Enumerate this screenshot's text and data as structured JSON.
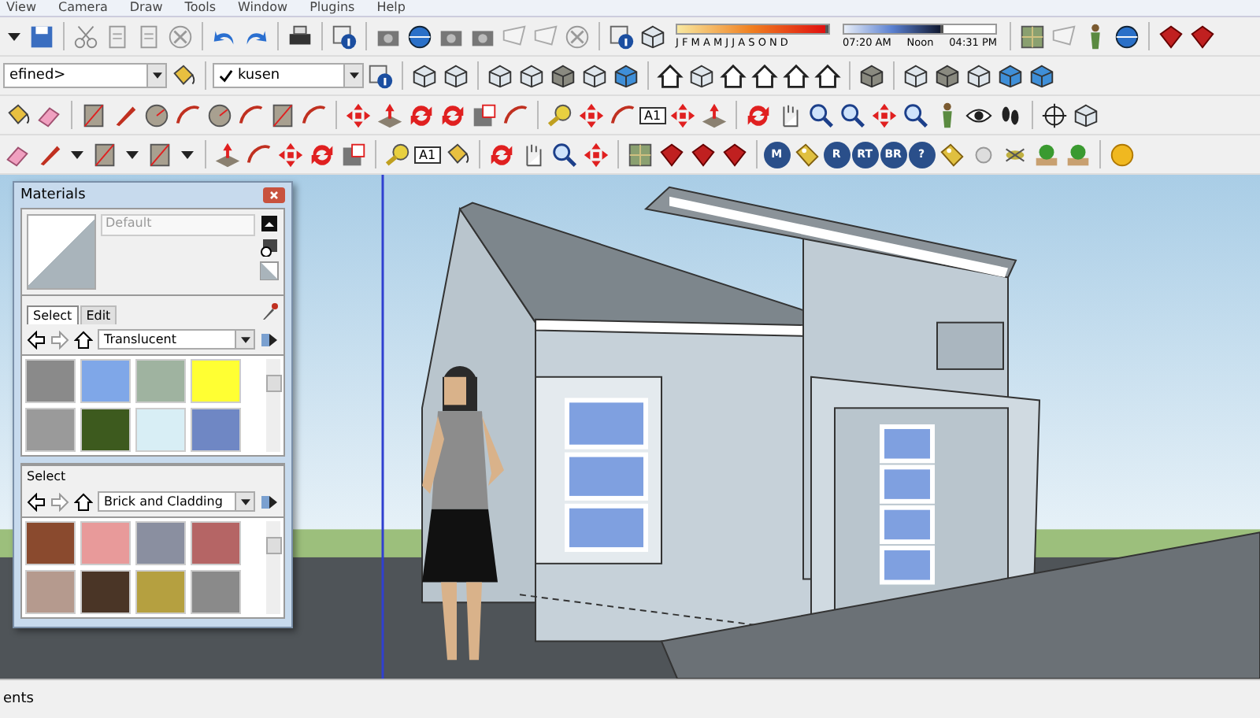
{
  "menu_bar": {
    "items": [
      "View",
      "Camera",
      "Draw",
      "Tools",
      "Window",
      "Plugins",
      "Help"
    ]
  },
  "layer_toolbar": {
    "layer": "efined>",
    "material": "kusen",
    "checked": true
  },
  "shadow_toolbar": {
    "month_slider": {
      "level": 1
    },
    "time_slider": {
      "level": 0.66
    },
    "months": "J F M A M J J A S O N D",
    "time_start": "07:20 AM",
    "time_middle": "Noon",
    "time_end": "04:31 PM"
  },
  "tool_labels": {
    "text_tool_row3": "A1",
    "text_tool_row4": "A1",
    "plugin_badges": [
      "M",
      "R",
      "RT",
      "BR",
      "?"
    ]
  },
  "materials": {
    "title": "Materials",
    "material_name": "Default",
    "tabs": [
      {
        "label": "Select",
        "selected": true
      },
      {
        "label": "Edit",
        "selected": false
      }
    ],
    "collection": "Translucent",
    "swatches": [
      {
        "color": "#8a8a8a"
      },
      {
        "color": "#7fa7e8"
      },
      {
        "color": "#9fb3a0"
      },
      {
        "color": "#ffff33"
      },
      {
        "color": "#9a9a9a"
      },
      {
        "color": "#3d5a1e"
      },
      {
        "color": "#d8eef5"
      },
      {
        "color": "#6f87c4"
      }
    ],
    "second_label": "Select",
    "second_collection": "Brick and Cladding",
    "second_swatches": [
      {
        "color": "#8a4a2e"
      },
      {
        "color": "#e89a9a"
      },
      {
        "color": "#8a8fa0"
      },
      {
        "color": "#b56565"
      },
      {
        "color": "#b59a8e"
      },
      {
        "color": "#4a3526"
      },
      {
        "color": "#b5a040"
      },
      {
        "color": "#8a8a8a"
      }
    ]
  },
  "status_bar": {
    "text": "ents"
  }
}
